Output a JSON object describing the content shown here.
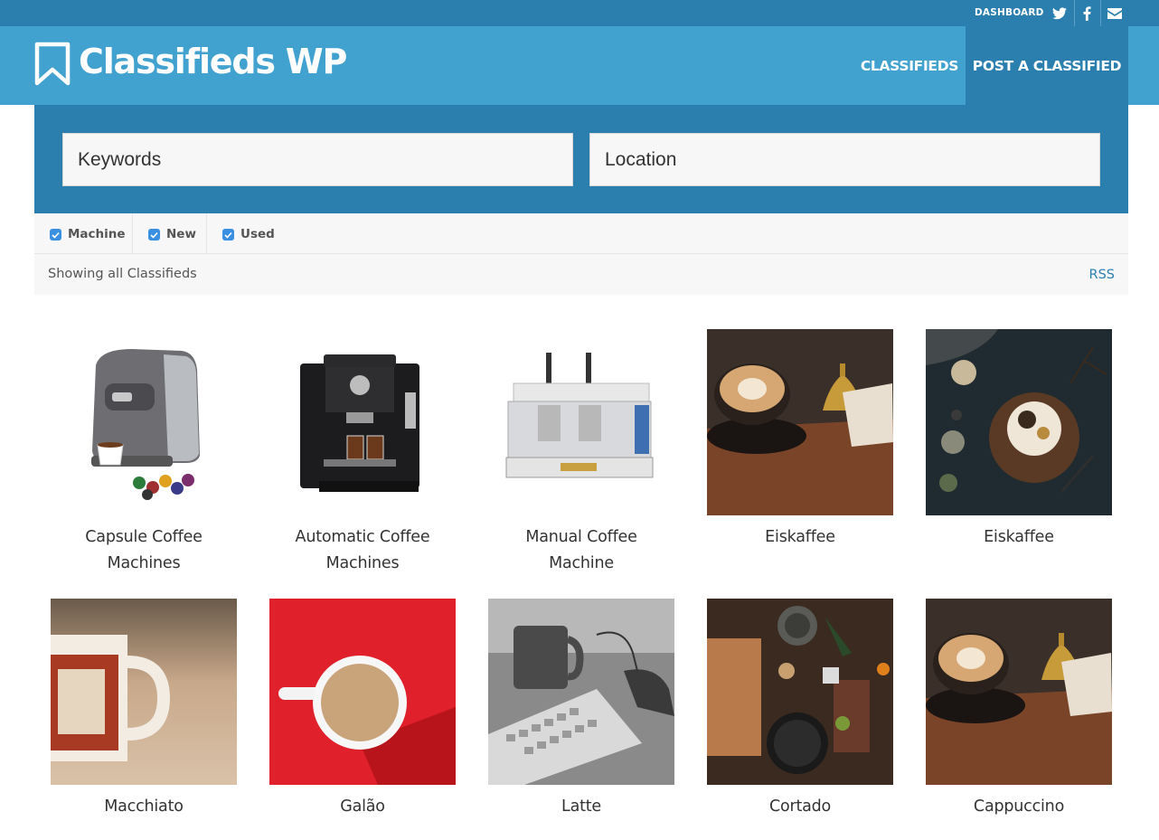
{
  "topbar": {
    "dashboard_label": "DASHBOARD",
    "icons": [
      "twitter-icon",
      "facebook-icon",
      "email-icon"
    ]
  },
  "header": {
    "site_title": "Classifieds WP",
    "nav": {
      "classifieds": "CLASSIFIEDS",
      "post": "POST A CLASSIFIED"
    }
  },
  "search": {
    "keywords_placeholder": "Keywords",
    "location_placeholder": "Location"
  },
  "filters": [
    {
      "label": "Machine",
      "checked": true
    },
    {
      "label": "New",
      "checked": true
    },
    {
      "label": "Used",
      "checked": true
    }
  ],
  "status": {
    "showing": "Showing all Classifieds",
    "rss": "RSS"
  },
  "listings": [
    {
      "title": "Capsule Coffee Machines",
      "image": "capsule-machine"
    },
    {
      "title": "Automatic Coffee Machines",
      "image": "automatic-machine"
    },
    {
      "title": "Manual Coffee Machine",
      "image": "manual-machine"
    },
    {
      "title": "Eiskaffee",
      "image": "latte-art-bell"
    },
    {
      "title": "Eiskaffee",
      "image": "dessert-table"
    },
    {
      "title": "Macchiato",
      "image": "mug"
    },
    {
      "title": "Galão",
      "image": "red-cup"
    },
    {
      "title": "Latte",
      "image": "keyboard-mug"
    },
    {
      "title": "Cortado",
      "image": "kitchen-table"
    },
    {
      "title": "Cappuccino",
      "image": "latte-art-bell"
    }
  ],
  "colors": {
    "header": "#41a1cf",
    "dark_blue": "#2a7faf",
    "panel": "#f7f7f7"
  }
}
